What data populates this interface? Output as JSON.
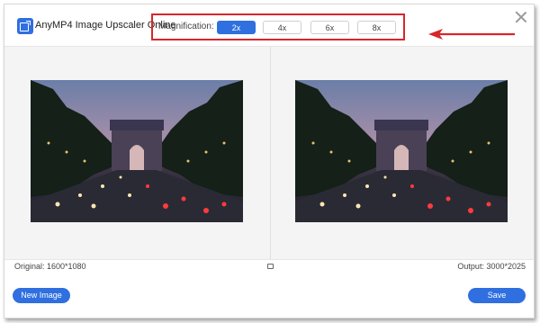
{
  "app": {
    "title": "AnyMP4 Image Upscaler Online",
    "logo_icon": "image-upscale-icon"
  },
  "magnification": {
    "label": "Magnification:",
    "options": [
      "2x",
      "4x",
      "6x",
      "8x"
    ],
    "selected": "2x"
  },
  "annotation": {
    "color": "#d7262b",
    "icon": "red-arrow-icon"
  },
  "preview": {
    "original_info": "Original: 1600*1080",
    "output_info": "Output: 3000*2025",
    "compare_icon": "compare-icon"
  },
  "actions": {
    "new_image": "New Image",
    "save": "Save"
  },
  "colors": {
    "accent": "#2f6fe0",
    "highlight_border": "#d7262b"
  }
}
